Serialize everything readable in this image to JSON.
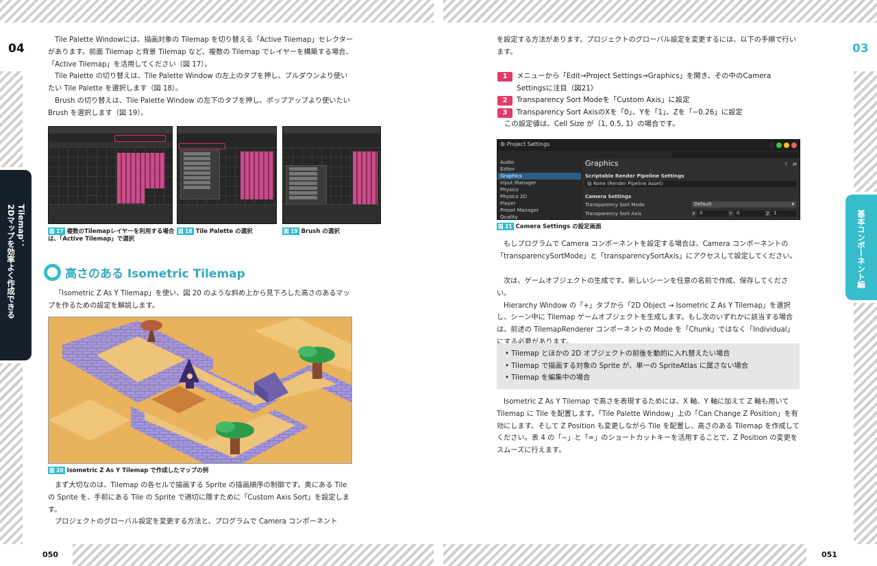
{
  "left_page": {
    "chapter_num": "04",
    "page_num": "050",
    "side_tab": [
      "Tilemap：",
      "2Dマップを効率よく作成できる"
    ],
    "intro_paragraphs": [
      "Tile Palette Windowには、描画対象の Tilemap を切り替える「Active Tilemap」セレクターがあります。前面 Tilemap と背景 Tilemap など、複数の Tilemap でレイヤーを構築する場合、「Active Tilemap」を活用してください（図 17）。",
      "Tile Palette の切り替えは、Tile Palette Window の左上のタブを押し、プルダウンより使いたい Tile Palette を選択します（図 18）。",
      "Brush の切り替えは、Tile Palette Window の左下のタブを押し、ポップアップより使いたい Brush を選択します（図 19）。"
    ],
    "figures": [
      {
        "fig_label": "図 17",
        "caption": "複数のTilemapレイヤーを利用する場合は、「Active Tilemap」で選択"
      },
      {
        "fig_label": "図 18",
        "caption": "Tile Palette の選択"
      },
      {
        "fig_label": "図 19",
        "caption": "Brush の選択"
      }
    ],
    "section_title": "高さのある Isometric Tilemap",
    "section_intro": "「Isometric Z As Y Tilemap」を使い、図 20 のような斜め上から見下ろした高さのあるマップを作るための設定を解説します。",
    "fig20_label": "図 20",
    "fig20_caption": "Isometric Z As Y Tilemap で作成したマップの例",
    "bottom_paragraphs": [
      "まず大切なのは、Tilemap の各セルで描画する Sprite の描画順序の制御です。奥にある Tile の Sprite を、手前にある Tile の Sprite で適切に隠すために「Custom Axis Sort」を設定します。",
      "プロジェクトのグローバル設定を変更する方法と、プログラムで Camera コンポーネント"
    ]
  },
  "right_page": {
    "chapter_num": "03",
    "page_num": "051",
    "side_tab": "基本コンポーネント編",
    "top_paragraph": "を設定する方法があります。プロジェクトのグローバル設定を変更するには、以下の手順で行います。",
    "steps": [
      {
        "num": "1",
        "text": "メニューから「Edit→Project Settings→Graphics」を開き、その中のCamera Settingsに注目（図21）"
      },
      {
        "num": "2",
        "text": "Transparency Sort Modeを「Custom Axis」に設定"
      },
      {
        "num": "3",
        "text": "Transparency Sort AxisのXを「0」、Yを「1」、Zを「−0.26」に設定"
      }
    ],
    "steps_note": "この設定値は、Cell Size が（1, 0.5, 1）の場合です。",
    "unity_window": {
      "tab_title": "Project Settings",
      "left_items": [
        "Audio",
        "Editor",
        "Graphics",
        "Input Manager",
        "Physics",
        "Physics 2D",
        "Player",
        "Preset Manager",
        "Quality"
      ],
      "selected_item": "Graphics",
      "panel_title": "Graphics",
      "section1": "Scriptable Render Pipeline Settings",
      "pipeline_value": "None (Render Pipeline Asset)",
      "section2": "Camera Settings",
      "sort_mode_label": "Transparency Sort Mode",
      "sort_mode_value": "Default",
      "sort_axis_label": "Transparency Sort Axis",
      "axis": [
        {
          "k": "X",
          "v": "0"
        },
        {
          "k": "Y",
          "v": "0"
        },
        {
          "k": "Z",
          "v": "1"
        }
      ]
    },
    "fig21_label": "図 21",
    "fig21_caption": "Camera Settings の設定画面",
    "para_a": "もしプログラムで Camera コンポーネントを設定する場合は、Camera コンポーネントの「transparencySortMode」と「transparencySortAxis」にアクセスして設定してください。",
    "para_b": [
      "次は、ゲームオブジェクトの生成です。新しいシーンを任意の名前で作成、保存してください。",
      "Hierarchy Window の「+」タブから「2D Object → Isometric Z As Y Tilemap」を選択し、シーン中に Tilemap ゲームオブジェクトを生成します。もし次のいずれかに該当する場合は、前述の TilemapRenderer コンポーネントの Mode を「Chunk」ではなく「Individual」にする必要があります。"
    ],
    "bullets": [
      "Tilemap とほかの 2D オブジェクトの前後を動的に入れ替えたい場合",
      "Tilemap で描画する対象の Sprite が、単一の SpriteAtlas に属さない場合",
      "Tilemap を編集中の場合"
    ],
    "para_c": "Isometric Z As Y Tilemap で高さを表現するためには、X 軸、Y 軸に加えて Z 軸も用いて Tilemap に Tile を配置します。「Tile Palette Window」上の「Can Change Z Position」を有効にします。そして Z Position も変更しながら Tile を配置し、高さのある Tilemap を作成してください。表 4 の「−」と「=」のショートカットキーを活用することで、Z Position の変更をスムーズに行えます。"
  },
  "colors": {
    "accent_cyan": "#36bccb",
    "step_pink": "#e23b6a",
    "dark_tab": "#15202b"
  }
}
